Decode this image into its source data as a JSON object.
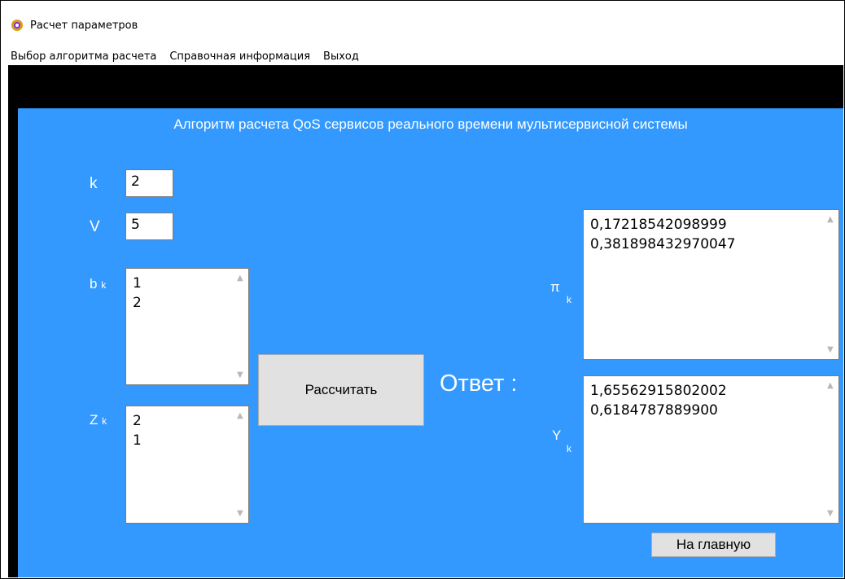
{
  "window": {
    "title": "Расчет параметров"
  },
  "menu": {
    "items": [
      "Выбор алгоритма расчета",
      "Справочная информация",
      "Выход"
    ]
  },
  "panel": {
    "heading": "Алгоритм расчета QoS сервисов реального времени мультисервисной системы",
    "k": {
      "label": "k",
      "value": "2"
    },
    "v": {
      "label": "V",
      "value": "5"
    },
    "bk": {
      "label": "b",
      "sub": "k",
      "lines": [
        "1",
        "2"
      ]
    },
    "zk": {
      "label": "Z",
      "sub": "k",
      "lines": [
        "2",
        "1"
      ]
    },
    "calc_button": "Рассчитать",
    "answer_label": "Ответ :",
    "pik": {
      "label": "π",
      "sub": "k",
      "lines": [
        "0,17218542098999",
        "0,381898432970047"
      ]
    },
    "yk": {
      "label": "Y",
      "sub": "k",
      "lines": [
        "1,65562915802002",
        "0,6184787889900"
      ]
    },
    "home_button": "На главную"
  },
  "colors": {
    "panel_bg": "#3399ff",
    "text": "#ffffff"
  },
  "icons": {
    "app": "settings-gear-icon",
    "scroll_up": "chevron-up-icon",
    "scroll_down": "chevron-down-icon"
  }
}
